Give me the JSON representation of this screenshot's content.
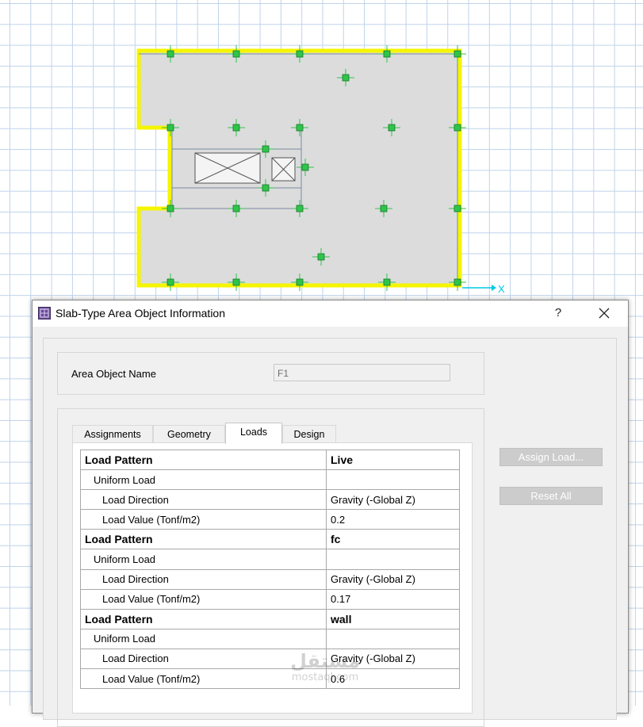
{
  "canvas": {
    "axis_x_label": "X",
    "slab_outline_color": "#f5f500",
    "slab_fill_color": "#dcdcdc",
    "column_color": "#2fc44a"
  },
  "dialog": {
    "title": "Slab-Type Area Object Information",
    "help_label": "?",
    "area_object_name_label": "Area Object Name",
    "area_object_name_value": "F1",
    "tabs": [
      {
        "label": "Assignments",
        "active": false
      },
      {
        "label": "Geometry",
        "active": false
      },
      {
        "label": "Loads",
        "active": true
      },
      {
        "label": "Design",
        "active": false
      }
    ],
    "rows": [
      {
        "label": "Load Pattern",
        "value": "Live",
        "level": 0
      },
      {
        "label": "Uniform Load",
        "value": "",
        "level": 1
      },
      {
        "label": "Load Direction",
        "value": "Gravity (-Global Z)",
        "level": 2
      },
      {
        "label": "Load Value  (Tonf/m2)",
        "value": "0.2",
        "level": 2
      },
      {
        "label": "Load Pattern",
        "value": "fc",
        "level": 0
      },
      {
        "label": "Uniform Load",
        "value": "",
        "level": 1
      },
      {
        "label": "Load Direction",
        "value": "Gravity (-Global Z)",
        "level": 2
      },
      {
        "label": "Load Value  (Tonf/m2)",
        "value": "0.17",
        "level": 2
      },
      {
        "label": "Load Pattern",
        "value": "wall",
        "level": 0
      },
      {
        "label": "Uniform Load",
        "value": "",
        "level": 1
      },
      {
        "label": "Load Direction",
        "value": "Gravity (-Global Z)",
        "level": 2
      },
      {
        "label": "Load Value  (Tonf/m2)",
        "value": "0.6",
        "level": 2
      }
    ],
    "assign_load_label": "Assign Load...",
    "reset_all_label": "Reset All"
  },
  "watermark": {
    "arabic": "مستقل",
    "latin": "mostaql.com"
  }
}
